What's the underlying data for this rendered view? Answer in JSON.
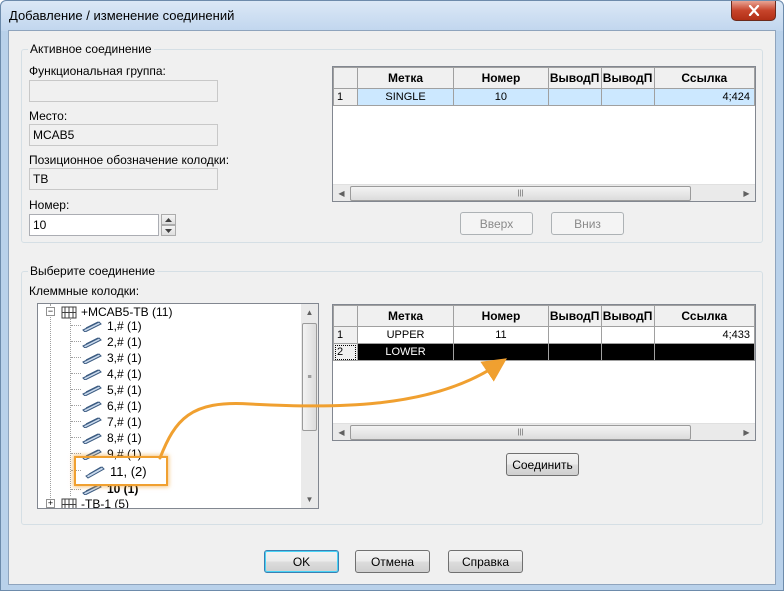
{
  "window": {
    "title": "Добавление / изменение соединений"
  },
  "active": {
    "legend": "Активное соединение",
    "func_group_label": "Функциональная группа:",
    "func_group_value": "",
    "place_label": "Место:",
    "place_value": "MCAB5",
    "terminal_label": "Позиционное обозначение колодки:",
    "terminal_value": "TB",
    "number_label": "Номер:",
    "number_value": "10",
    "grid": {
      "columns": [
        "Метка",
        "Номер",
        "ВыводП",
        "ВыводП",
        "Ссылка"
      ],
      "rows": [
        {
          "index": "1",
          "label": "SINGLE",
          "number": "10",
          "out1": "",
          "out2": "",
          "ref": "4;424"
        }
      ]
    },
    "up_button": "Вверх",
    "down_button": "Вниз"
  },
  "select": {
    "legend": "Выберите соединение",
    "terminals_label": "Клеммные колодки:",
    "tree": {
      "root": "+MCAB5-TB (11)",
      "items": [
        "1,# (1)",
        "2,# (1)",
        "3,# (1)",
        "4,# (1)",
        "5,# (1)",
        "6,# (1)",
        "7,# (1)",
        "8,# (1)",
        "9,# (1)",
        "11,  (2)",
        "10 (1)"
      ],
      "next_root": "-TB-1 (5)"
    },
    "grid": {
      "columns": [
        "Метка",
        "Номер",
        "ВыводП",
        "ВыводП",
        "Ссылка"
      ],
      "rows": [
        {
          "index": "1",
          "label": "UPPER",
          "number": "11",
          "out1": "",
          "out2": "",
          "ref": "4;433"
        },
        {
          "index": "2",
          "label": "LOWER",
          "number": "",
          "out1": "",
          "out2": "",
          "ref": ""
        }
      ]
    },
    "connect_button": "Соединить"
  },
  "footer": {
    "ok": "OK",
    "cancel": "Отмена",
    "help": "Справка"
  },
  "colors": {
    "highlight": "#f0a030",
    "selection_blue": "#cce8ff",
    "selection_black": "#000000"
  }
}
